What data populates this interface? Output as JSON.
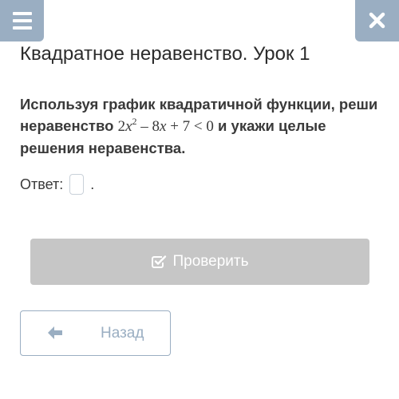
{
  "header": {
    "menu_icon": "hamburger-menu-icon",
    "close_icon": "close-x-icon",
    "accent_color": "#9aaec2"
  },
  "lesson": {
    "title": "Квадратное неравенство. Урок 1"
  },
  "task": {
    "text_before": "Используя график квадратичной функции, реши неравенство",
    "inequality": {
      "coef_a": "2",
      "var": "x",
      "exponent": "2",
      "middle": " – 8",
      "var2": "x",
      "tail": " + 7 < 0"
    },
    "text_after": "и укажи целые решения неравенства."
  },
  "answer": {
    "label": "Ответ:",
    "value": "",
    "dot": "."
  },
  "check_button": {
    "label": "Проверить",
    "icon": "checkbox-check-icon",
    "color": "#c6c6c6"
  },
  "back_button": {
    "label": "Назад",
    "icon": "arrow-left-icon"
  }
}
